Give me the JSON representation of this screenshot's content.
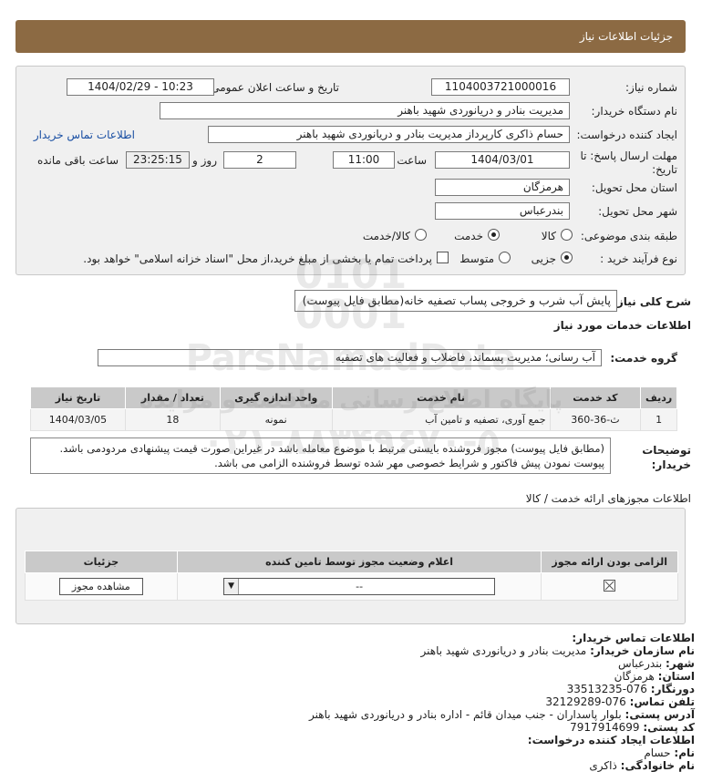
{
  "header": {
    "title": "جزئیات اطلاعات نیاز"
  },
  "form": {
    "need_number_label": "شماره نیاز:",
    "need_number": "1104003721000016",
    "announce_label": "تاریخ و ساعت اعلان عمومی:",
    "announce_value": "1404/02/29 - 10:23",
    "buyer_org_label": "نام دستگاه خریدار:",
    "buyer_org": "مدیریت بنادر و دریانوردی شهید باهنر",
    "creator_label": "ایجاد کننده درخواست:",
    "creator": "حسام  ذاکری کارپرداز مدیریت بنادر و دریانوردی شهید باهنر",
    "contact_link": "اطلاعات تماس خریدار",
    "deadline_label": "مهلت ارسال پاسخ: تا تاریخ:",
    "deadline_date": "1404/03/01",
    "time_label": "ساعت",
    "deadline_time": "11:00",
    "days_value": "2",
    "days_label": "روز و",
    "remaining_value": "23:25:15",
    "remaining_label": "ساعت باقی مانده",
    "province_label": "استان محل تحویل:",
    "province": "هرمزگان",
    "city_label": "شهر محل تحویل:",
    "city": "بندرعباس",
    "category_label": "طبقه بندی موضوعی:",
    "category_options": [
      "کالا",
      "خدمت",
      "کالا/خدمت"
    ],
    "category_selected": 1,
    "process_label": "نوع فرآیند خرید :",
    "process_options": [
      "جزیی",
      "متوسط"
    ],
    "process_selected": 0,
    "payment_note": "پرداخت تمام یا بخشی از مبلغ خرید،از محل \"اسناد خزانه اسلامی\" خواهد بود."
  },
  "summary": {
    "label": "شرح کلی نیاز:",
    "value": "پایش آب شرب و خروجی پساب تصفیه خانه(مطابق فایل پیوست)"
  },
  "services": {
    "section_title": "اطلاعات خدمات مورد نیاز",
    "group_label": "گروه خدمت:",
    "group_value": "آب رسانی؛ مدیریت پسماند، فاضلاب و فعالیت های تصفیه",
    "columns": [
      "ردیف",
      "کد خدمت",
      "نام خدمت",
      "واحد اندازه گیری",
      "تعداد / مقدار",
      "تاریخ نیاز"
    ],
    "rows": [
      [
        "1",
        "ث-36-360",
        "جمع آوری، تصفیه و تامین آب",
        "نمونه",
        "18",
        "1404/03/05"
      ]
    ]
  },
  "notes": {
    "label": "توضیحات خریدار:",
    "text": "(مطابق فایل پیوست) مجوز فروشنده بایستی مرتبط با موضوع معامله باشد در غیراین صورت قیمت پیشنهادی مردودمی باشد. پیوست نمودن پیش فاکتور و شرایط خصوصی مهر شده توسط فروشنده الزامی می باشد."
  },
  "licenses": {
    "section_title": "اطلاعات مجوزهای ارائه خدمت / کالا",
    "columns": [
      "الزامی بودن ارائه مجوز",
      "اعلام وضعیت مجوز توسط تامین کننده",
      "جزئیات"
    ],
    "select_value": "--",
    "view_button": "مشاهده مجوز"
  },
  "contact": {
    "title": "اطلاعات تماس خریدار:",
    "items": [
      {
        "label": "نام سازمان خریدار:",
        "value": "مدیریت بنادر و دریانوردی شهید باهنر"
      },
      {
        "label": "شهر:",
        "value": "بندرعباس"
      },
      {
        "label": "استان:",
        "value": "هرمزگان"
      },
      {
        "label": "دورنگار:",
        "value": "076-33513235"
      },
      {
        "label": "تلفن تماس:",
        "value": "076-32129289"
      },
      {
        "label": "آدرس پستی:",
        "value": "بلوار پاسداران - جنب میدان قائم - اداره بنادر و دریانوردی شهید باهنر"
      },
      {
        "label": "کد پستی:",
        "value": "7917914699"
      },
      {
        "label": "اطلاعات ایجاد کننده درخواست:",
        "value": ""
      },
      {
        "label": "نام:",
        "value": "حسام"
      },
      {
        "label": "نام خانوادگی:",
        "value": "ذاکری"
      }
    ]
  },
  "watermark": {
    "line1": "0101",
    "line2": "0001",
    "line3": "ParsNamadData",
    "line4": "پایگاه اطلاع رسانی مناقصه و مزایده",
    "line5": "۰۲۱-۸۸۳۴۹۶۷۰-۵"
  }
}
